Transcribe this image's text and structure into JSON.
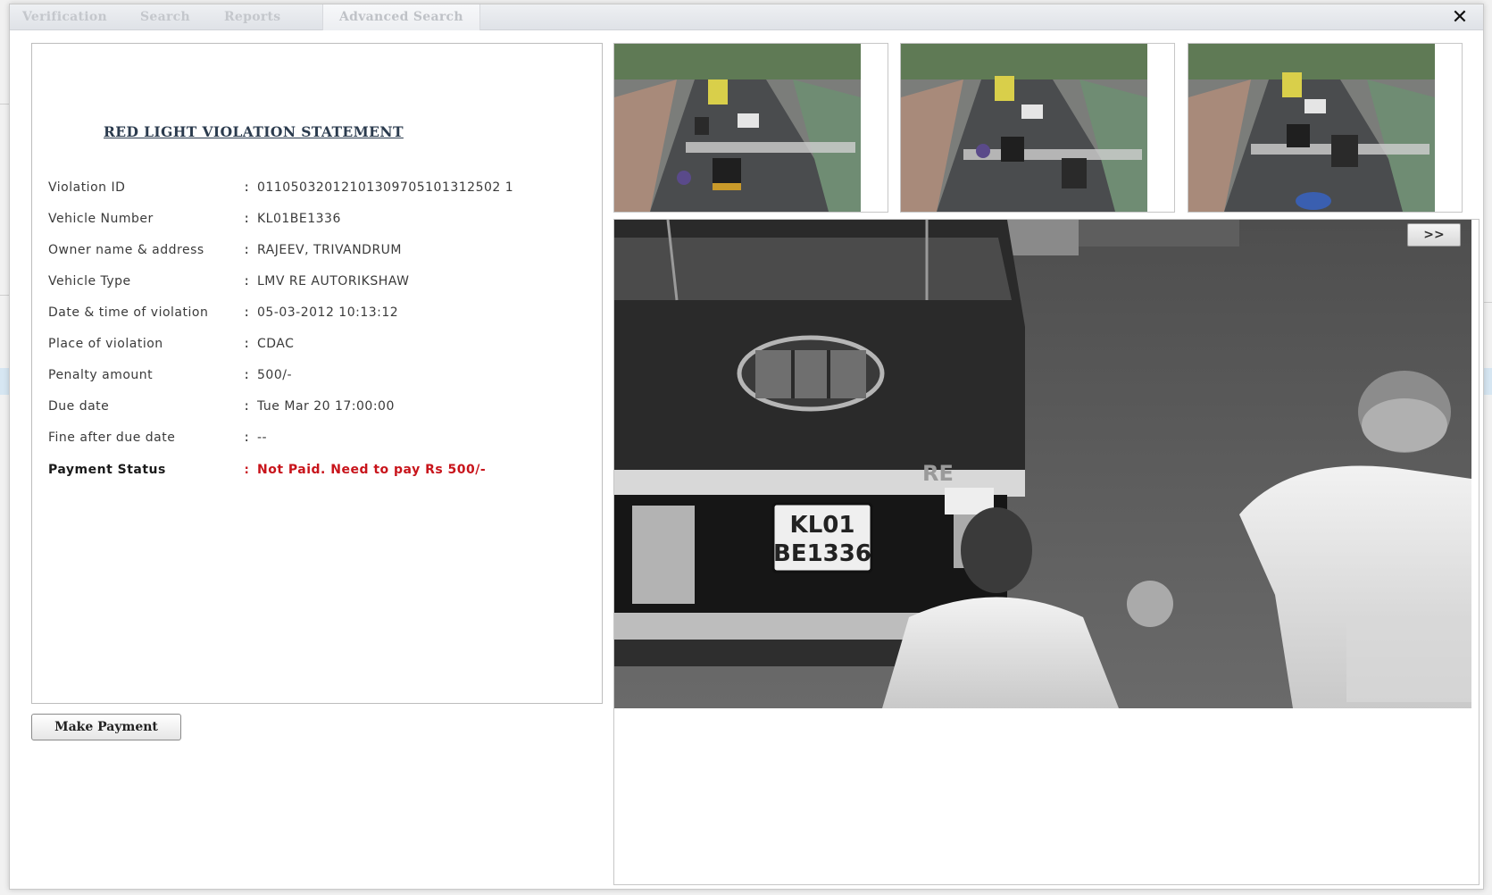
{
  "tabs": [
    {
      "label": "Verification"
    },
    {
      "label": "Search"
    },
    {
      "label": "Reports"
    },
    {
      "label": "Advanced Search"
    }
  ],
  "close_label": "✕",
  "statement": {
    "title": "RED LIGHT VIOLATION STATEMENT",
    "colon": ":",
    "rows": [
      {
        "label": "Violation ID",
        "value": "01105032012101309705101312502 1"
      },
      {
        "label": "Vehicle Number",
        "value": "KL01BE1336"
      },
      {
        "label": "Owner name & address",
        "value": "RAJEEV, TRIVANDRUM"
      },
      {
        "label": "Vehicle Type",
        "value": "LMV RE AUTORIKSHAW"
      },
      {
        "label": "Date & time of violation",
        "value": "05-03-2012 10:13:12"
      },
      {
        "label": "Place of violation",
        "value": "CDAC"
      },
      {
        "label": "Penalty amount",
        "value": "500/-"
      },
      {
        "label": "Due date",
        "value": "Tue Mar 20 17:00:00"
      },
      {
        "label": "Fine after due date",
        "value": "--"
      }
    ],
    "payment_status": {
      "label": "Payment Status",
      "value": "Not Paid. Need to pay Rs 500/-"
    }
  },
  "make_payment_label": "Make Payment",
  "next_label": ">>",
  "plate": {
    "line1": "KL01",
    "line2": "BE1336",
    "badge": "RE"
  },
  "colors": {
    "status_red": "#c8141b",
    "title_navy": "#2b3b4e"
  }
}
